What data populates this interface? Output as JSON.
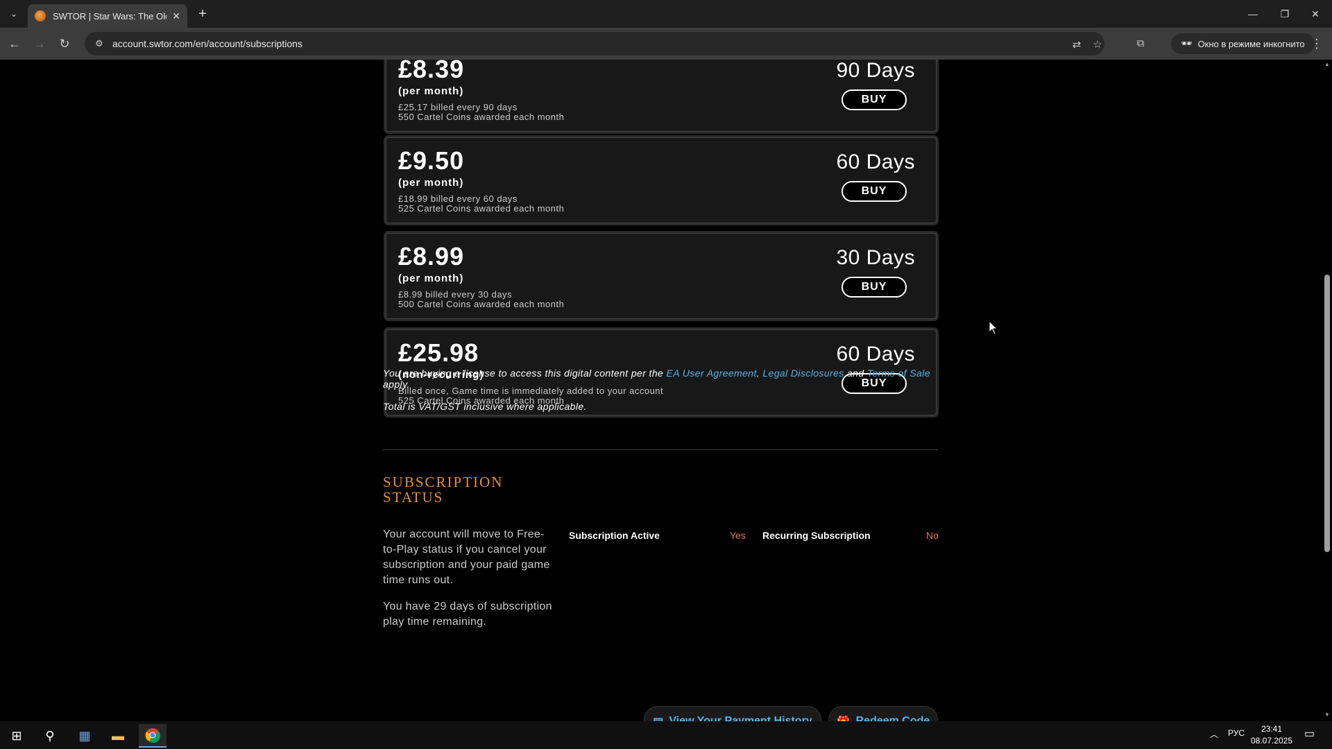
{
  "browser": {
    "tab_title": "SWTOR | Star Wars: The Old Republic",
    "url": "account.swtor.com/en/account/subscriptions",
    "incognito_label": "Окно в режиме инкогнито"
  },
  "plans": [
    {
      "price": "£8.39",
      "term": "(per month)",
      "billed": "£25.17 billed every 90 days",
      "coins": "550 Cartel Coins awarded each month",
      "days": "90 Days",
      "buy": "BUY"
    },
    {
      "price": "£9.50",
      "term": "(per month)",
      "billed": "£18.99 billed every 60 days",
      "coins": "525 Cartel Coins awarded each month",
      "days": "60 Days",
      "buy": "BUY"
    },
    {
      "price": "£8.99",
      "term": "(per month)",
      "billed": "£8.99 billed every 30 days",
      "coins": "500 Cartel Coins awarded each month",
      "days": "30 Days",
      "buy": "BUY"
    },
    {
      "price": "£25.98",
      "term": "(non-recurring)",
      "billed": "Billed once, Game time is immediately added to your account",
      "coins": "525 Cartel Coins awarded each month",
      "days": "60 Days",
      "buy": "BUY"
    }
  ],
  "license": {
    "prefix": "You are buying a license to access this digital content per the",
    "link1": "EA User Agreement",
    "sep": ".",
    "link2": "Legal Disclosures",
    "and": "and",
    "link3": "Terms of Sale",
    "suffix": "apply."
  },
  "vat_text": "Total is VAT/GST inclusive where applicable.",
  "status": {
    "heading_line1": "SUBSCRIPTION",
    "heading_line2": "STATUS",
    "description": "Your account will move to Free-to-Play status if you cancel your subscription and your paid game time runs out.",
    "remaining": "You have 29 days of subscription play time remaining.",
    "active_label": "Subscription Active",
    "active_value": "Yes",
    "recurring_label": "Recurring Subscription",
    "recurring_value": "No",
    "payment_history_button": "View Your Payment History",
    "redeem_button": "Redeem Code"
  },
  "taskbar": {
    "lang": "РУС",
    "time": "23:41",
    "date": "08.07.2025"
  }
}
